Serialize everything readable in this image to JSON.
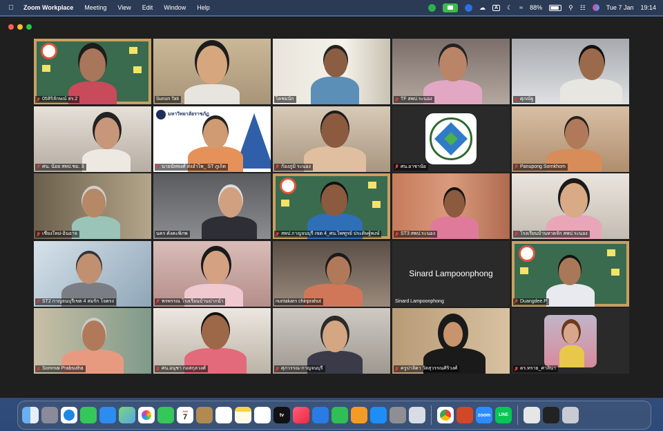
{
  "menubar": {
    "app_name": "Zoom Workplace",
    "menus": [
      "Meeting",
      "View",
      "Edit",
      "Window",
      "Help"
    ],
    "battery": "88%",
    "date": "Tue 7 Jan",
    "time": "19:14"
  },
  "participants": [
    {
      "name": "05สิริลักษณ์ สร.2"
    },
    {
      "name": "Sunun Tati"
    },
    {
      "name": "ไคชมนัก"
    },
    {
      "name": "TF สพป.ระนอง"
    },
    {
      "name": "ศุภณัฐ"
    },
    {
      "name": "ศน. น้อย สพป.ชม. 3"
    },
    {
      "name": "นายนัทพงศ์ ส่งอำไพ_ ST ภูเก็ต",
      "banner_text": "มหาวิทยาลัยราชภัฏ"
    },
    {
      "name": "ก้องภูมิ ระนอง"
    },
    {
      "name": "ศน.อาชานัย"
    },
    {
      "name": "Panupong Sornkhom"
    },
    {
      "name": "เชียงใหม่-อินอาจ"
    },
    {
      "name": "นคร คังคะพิภพ"
    },
    {
      "name": "สพป.กาญจนบุรี เขต 4_ศน.ไพฑูรย์ ประดิษฐ์พงษ์"
    },
    {
      "name": "ST3 สพป.ระนอง"
    },
    {
      "name": "โรงเรียนบ้านหาดจัก สพป.ระนอง"
    },
    {
      "name": "ST2 กาญจนบุรีเขต 4 สมรัก โจตรง"
    },
    {
      "name": "พรพรรณ  โรงเรียนบ้านปากน้ำ"
    },
    {
      "name": "nuntakarn chinprahut"
    },
    {
      "name": "Sinard Lampoonphong",
      "display_name_large": "Sinard Lampoonphong"
    },
    {
      "name": "Duangdee.P"
    },
    {
      "name": "Sommai Prabsutha"
    },
    {
      "name": "ศน.อนุชา กอสกุลวงศ์"
    },
    {
      "name": "ศุภวรรณ-กาญจนบุรี"
    },
    {
      "name": "ครูปาลิตา วัตสุวรรณศิริวงศ์"
    },
    {
      "name": "ดร.ทราย_ศาลินา"
    }
  ],
  "dock": {
    "calendar_month": "JAN",
    "calendar_day": "7",
    "appletv_label": "tv",
    "zoom_label": "zoom",
    "line_label": "LINE",
    "apps": [
      "finder-icon",
      "launchpad-icon",
      "safari-icon",
      "messages-icon",
      "mail-icon",
      "maps-icon",
      "photos-icon",
      "facetime-icon",
      "calendar-icon",
      "notes-icon",
      "reminders-icon",
      "freeform-icon",
      "appletv-icon",
      "music-icon",
      "keynote-icon",
      "numbers-icon",
      "pages-icon",
      "appstore-icon",
      "settings-icon",
      "preview-icon",
      "chrome-icon",
      "powerpoint-icon",
      "zoom-icon",
      "line-icon",
      "downloads-icon",
      "trash-icon"
    ]
  }
}
